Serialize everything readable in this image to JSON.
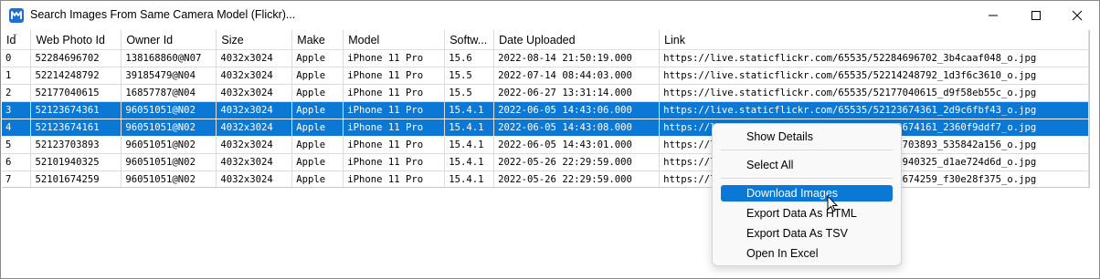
{
  "window": {
    "title": "Search Images From Same Camera Model (Flickr)..."
  },
  "columns": [
    "Id",
    "Web Photo Id",
    "Owner Id",
    "Size",
    "Make",
    "Model",
    "Softw...",
    "Date Uploaded",
    "Link"
  ],
  "rows": [
    {
      "id": "0",
      "photo_id": "52284696702",
      "owner": "138168860@N07",
      "size": "4032x3024",
      "make": "Apple",
      "model": "iPhone 11 Pro",
      "software": "15.6",
      "date": "2022-08-14 21:50:19.000",
      "link": "https://live.staticflickr.com/65535/52284696702_3b4caaf048_o.jpg",
      "selected": false
    },
    {
      "id": "1",
      "photo_id": "52214248792",
      "owner": "39185479@N04",
      "size": "4032x3024",
      "make": "Apple",
      "model": "iPhone 11 Pro",
      "software": "15.5",
      "date": "2022-07-14 08:44:03.000",
      "link": "https://live.staticflickr.com/65535/52214248792_1d3f6c3610_o.jpg",
      "selected": false
    },
    {
      "id": "2",
      "photo_id": "52177040615",
      "owner": "16857787@N04",
      "size": "4032x3024",
      "make": "Apple",
      "model": "iPhone 11 Pro",
      "software": "15.5",
      "date": "2022-06-27 13:31:14.000",
      "link": "https://live.staticflickr.com/65535/52177040615_d9f58eb55c_o.jpg",
      "selected": false
    },
    {
      "id": "3",
      "photo_id": "52123674361",
      "owner": "96051051@N02",
      "size": "4032x3024",
      "make": "Apple",
      "model": "iPhone 11 Pro",
      "software": "15.4.1",
      "date": "2022-06-05 14:43:06.000",
      "link": "https://live.staticflickr.com/65535/52123674361_2d9c6fbf43_o.jpg",
      "selected": true
    },
    {
      "id": "4",
      "photo_id": "52123674161",
      "owner": "96051051@N02",
      "size": "4032x3024",
      "make": "Apple",
      "model": "iPhone 11 Pro",
      "software": "15.4.1",
      "date": "2022-06-05 14:43:08.000",
      "link": "https://live.staticflickr.com/65535/52123674161_2360f9ddf7_o.jpg",
      "selected": true
    },
    {
      "id": "5",
      "photo_id": "52123703893",
      "owner": "96051051@N02",
      "size": "4032x3024",
      "make": "Apple",
      "model": "iPhone 11 Pro",
      "software": "15.4.1",
      "date": "2022-06-05 14:43:01.000",
      "link": "https://live.staticflickr.com/65535/52123703893_535842a156_o.jpg",
      "selected": false
    },
    {
      "id": "6",
      "photo_id": "52101940325",
      "owner": "96051051@N02",
      "size": "4032x3024",
      "make": "Apple",
      "model": "iPhone 11 Pro",
      "software": "15.4.1",
      "date": "2022-05-26 22:29:59.000",
      "link": "https://live.staticflickr.com/65535/52101940325_d1ae724d6d_o.jpg",
      "selected": false
    },
    {
      "id": "7",
      "photo_id": "52101674259",
      "owner": "96051051@N02",
      "size": "4032x3024",
      "make": "Apple",
      "model": "iPhone 11 Pro",
      "software": "15.4.1",
      "date": "2022-05-26 22:29:59.000",
      "link": "https://live.staticflickr.com/65535/52101674259_f30e28f375_o.jpg",
      "selected": false
    }
  ],
  "context_menu": {
    "items": [
      {
        "label": "Show Details",
        "name": "menu-show-details",
        "highlighted": false
      },
      {
        "label": "Select All",
        "name": "menu-select-all",
        "highlighted": false
      },
      {
        "label": "Download Images",
        "name": "menu-download-images",
        "highlighted": true
      },
      {
        "label": "Export Data As HTML",
        "name": "menu-export-html",
        "highlighted": false
      },
      {
        "label": "Export Data As TSV",
        "name": "menu-export-tsv",
        "highlighted": false
      },
      {
        "label": "Open In Excel",
        "name": "menu-open-excel",
        "highlighted": false
      }
    ]
  },
  "colors": {
    "selection": "#0a78d4",
    "app_icon": "#1e6fd1"
  },
  "icons": {
    "app": "app-logo-icon",
    "minimize": "minimize-icon",
    "maximize": "maximize-icon",
    "close": "close-icon",
    "sort": "sort-caret-icon",
    "cursor": "mouse-pointer-icon"
  }
}
